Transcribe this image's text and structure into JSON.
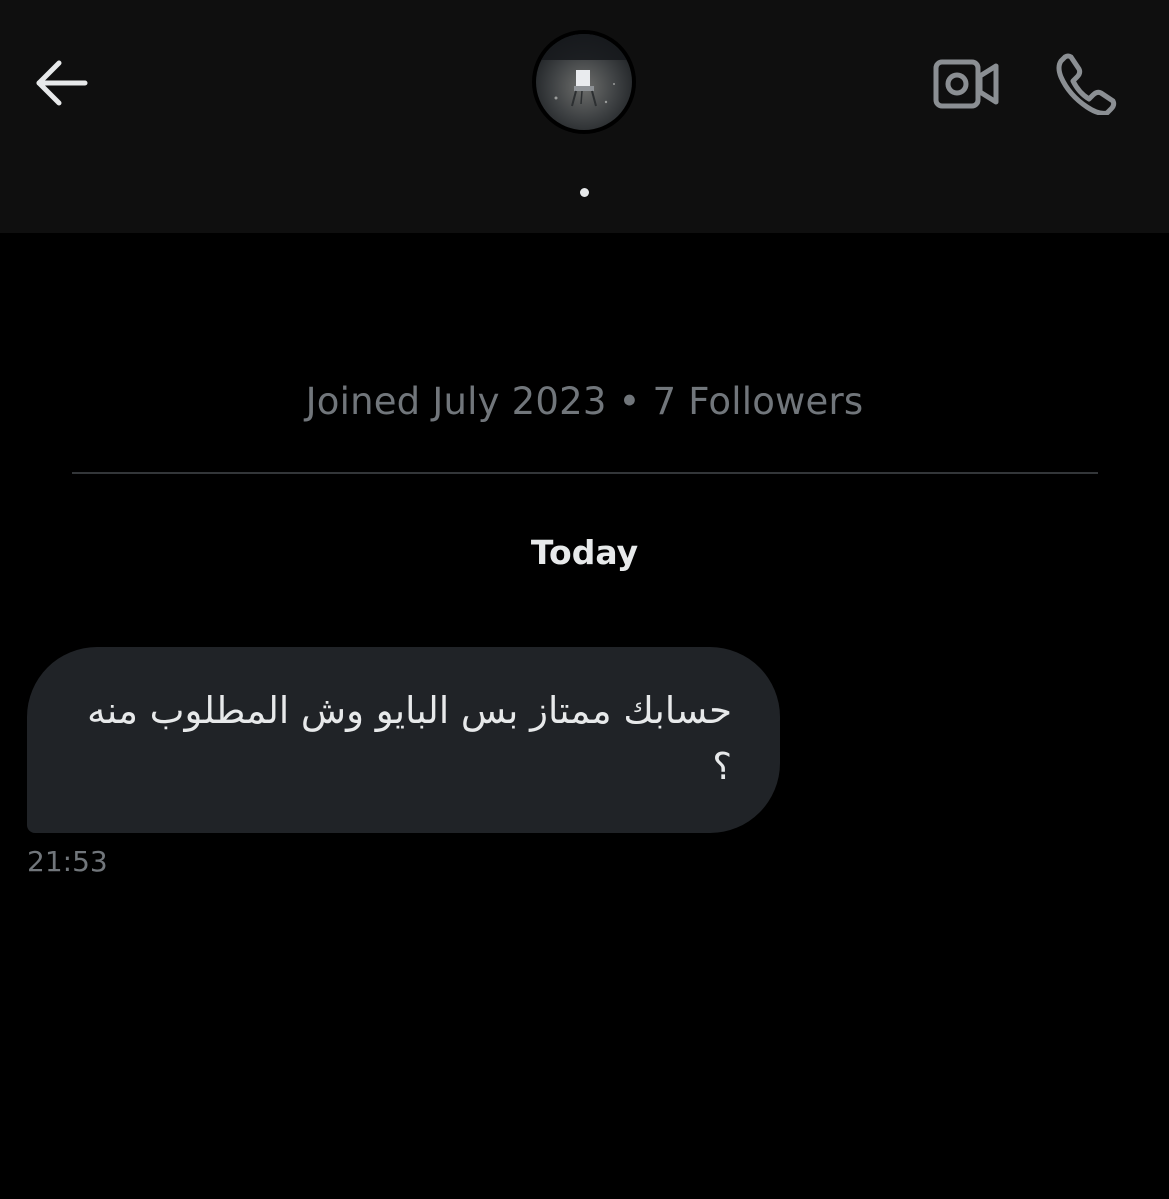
{
  "header": {
    "back_icon": "arrow-left-icon",
    "video_icon": "video-camera-icon",
    "call_icon": "phone-icon",
    "avatar_icon": "profile-photo"
  },
  "profile": {
    "meta": "Joined July 2023 • 7 Followers"
  },
  "conversation": {
    "date_separator": "Today",
    "messages": [
      {
        "text": "حسابك ممتاز بس البايو وش المطلوب منه ؟",
        "time": "21:53"
      }
    ]
  },
  "colors": {
    "background": "#000000",
    "header_bg": "#0f0f0f",
    "bubble": "#202327",
    "text": "#e7e9ea",
    "muted": "#71767b",
    "icon": "#e7e9ea",
    "icon_muted": "#8b8f93"
  }
}
